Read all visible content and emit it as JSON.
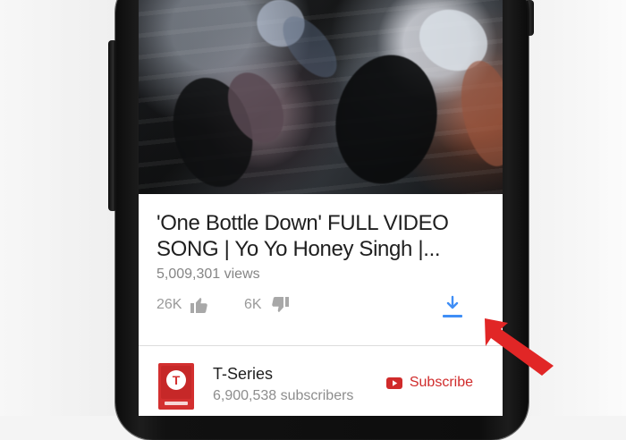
{
  "video": {
    "title": "'One Bottle Down' FULL VIDEO\nSONG | Yo Yo Honey Singh |...",
    "views": "5,009,301 views"
  },
  "actions": {
    "like_count": "26K",
    "dislike_count": "6K",
    "like_icon": "thumbs-up-icon",
    "dislike_icon": "thumbs-down-icon",
    "download_icon": "download-icon"
  },
  "channel": {
    "name": "T-Series",
    "subscribers": "6,900,538 subscribers",
    "logo_text": "T",
    "subscribe_label": "Subscribe",
    "subscribe_icon": "youtube-play-icon"
  },
  "annotations": {
    "pointer_icon": "red-arrow-icon"
  },
  "colors": {
    "accent_red": "#d02b2b",
    "download_blue": "#3f8ef6",
    "arrow_red": "#e12626"
  }
}
